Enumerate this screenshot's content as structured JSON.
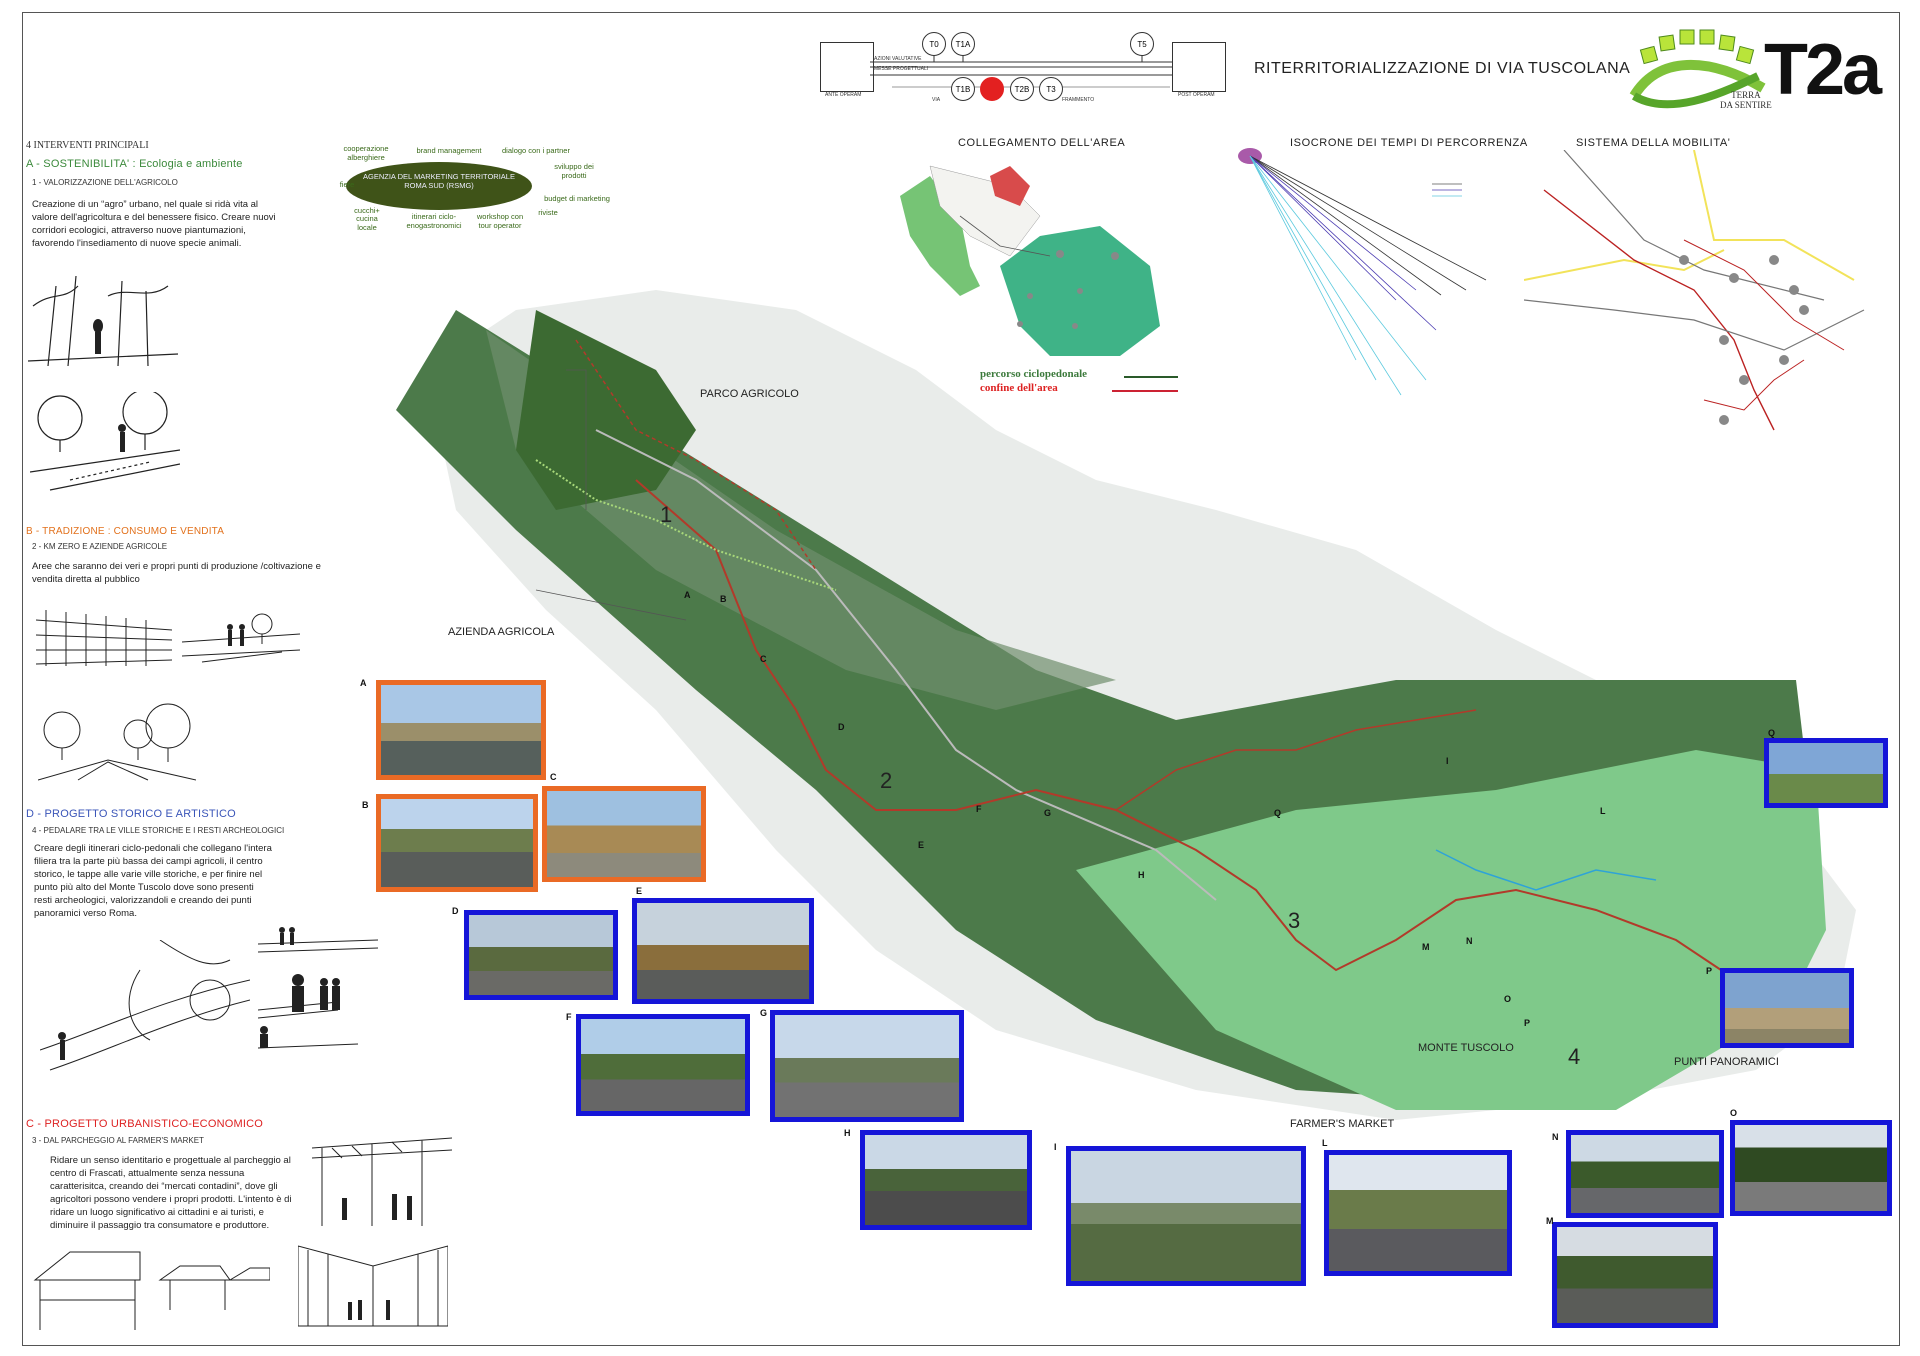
{
  "header": {
    "title": "RITERRITORIALIZZAZIONE DI VIA TUSCOLANA",
    "code": "T2a",
    "logo_text": "TERRA DA SENTIRE",
    "logo_line1": "TERRA",
    "logo_line2": "DA SENTIRE"
  },
  "timeline": {
    "ante_label": "ANTE OPERAM",
    "post_label": "POST OPERAM",
    "row1": "AZIONI VALUTATIVE",
    "row2": "MESSE PROGETTUALI",
    "via": "VIA",
    "frammento": "FRAMMENTO",
    "nodes_top": [
      "T0",
      "T1A",
      "T5"
    ],
    "nodes_bottom": [
      "T1B",
      "T2B",
      "T3"
    ],
    "active_color": "#e32020"
  },
  "left": {
    "interventi_title": "4 INTERVENTI PRINCIPALI",
    "A_title": "A - SOSTENIBILITA' : Ecologia e ambiente",
    "A_sub": "1 - VALORIZZAZIONE DELL'AGRICOLO",
    "A_body": "Creazione di un “agro” urbano, nel quale si ridà vita al valore dell'agricoltura e del benessere fisico. Creare nuovi corridori ecologici, attraverso nuove piantumazioni, favorendo l'insediamento di nuove specie animali.",
    "B_title": "B - TRADIZIONE : CONSUMO E VENDITA",
    "B_sub": "2 - KM ZERO E AZIENDE AGRICOLE",
    "B_body": "Aree che saranno dei veri e propri punti di produzione /coltivazione e vendita diretta al pubblico",
    "D_title": "D - PROGETTO STORICO E ARTISTICO",
    "D_sub": "4 - PEDALARE TRA LE VILLE STORICHE E I RESTI ARCHEOLOGICI",
    "D_body": "Creare degli itinerari ciclo-pedonali che collegano l'intera filiera tra la parte più bassa dei campi agricoli, il centro storico, le tappe alle varie ville storiche, e per finire nel punto più alto del Monte Tuscolo dove sono presenti resti archeologici, valorizzandoli e creando dei punti panoramici verso Roma.",
    "C_title": "C - PROGETTO URBANISTICO-ECONOMICO",
    "C_sub": "3 - DAL PARCHEGGIO AL FARMER'S MARKET",
    "C_body": "Ridare un senso identitario e progettuale al parcheggio al centro di Frascati, attualmente senza nessuna caratterisitca, creando dei “mercati contadini”, dove gli agricoltori possono vendere i propri prodotti. L'intento è di ridare un luogo significativo ai cittadini e ai turisti, e diminuire il passaggio tra consumatore e produttore."
  },
  "marketing": {
    "center": "AGENZIA DEL MARKETING TERRITORIALE ROMA SUD (RSMG)",
    "items": [
      "cooperazione alberghiere",
      "brand management",
      "dialogo con i partner",
      "sviluppo dei prodotti",
      "fiere",
      "budget di marketing",
      "cucina locale",
      "cucchi+",
      "itinerari ciclo-enogastronomici",
      "workshop con tour operator",
      "riviste"
    ]
  },
  "panels": {
    "collegamento": "COLLEGAMENTO DELL'AREA",
    "isocrone": "ISOCRONE DEI TEMPI DI PERCORRENZA",
    "mobilita": "SISTEMA DELLA MOBILITA'",
    "legend_bike": "percorso ciclopedonale",
    "legend_border": "confine dell'area"
  },
  "map": {
    "parco_agricolo": "PARCO AGRICOLO",
    "azienda_agricola": "AZIENDA AGRICOLA",
    "monte_tuscolo": "MONTE TUSCOLO",
    "farmers_market": "FARMER'S MARKET",
    "punti_panoramici": "PUNTI PANORAMICI",
    "numbers": [
      "1",
      "2",
      "3",
      "4"
    ],
    "point_letters": [
      "A",
      "B",
      "C",
      "D",
      "E",
      "F",
      "G",
      "H",
      "I",
      "L",
      "M",
      "N",
      "O",
      "P",
      "Q"
    ]
  },
  "photos": [
    "A",
    "B",
    "C",
    "D",
    "E",
    "F",
    "G",
    "H",
    "I",
    "L",
    "M",
    "N",
    "O",
    "P",
    "Q"
  ],
  "colors": {
    "photo_frame_blue": "#1515d8",
    "photo_frame_orange": "#ea6a25",
    "map_green": "#4c7a4a",
    "route_red": "#b23a2a",
    "park_green": "#7fc98a"
  }
}
